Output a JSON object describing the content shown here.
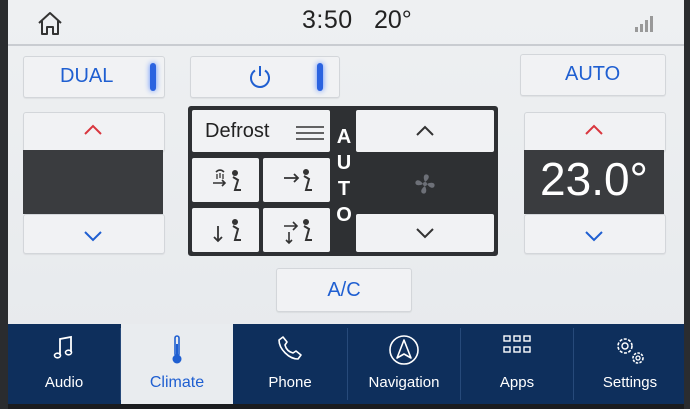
{
  "status_bar": {
    "time": "3:50",
    "outside_temp": "20°",
    "icons": [
      "home-icon",
      "signal-icon"
    ]
  },
  "climate": {
    "dual_label": "DUAL",
    "auto_label": "AUTO",
    "power_icon": "power-icon",
    "right_temp": "23.0°",
    "defrost_label": "Defrost",
    "auto_vertical": [
      "A",
      "U",
      "T",
      "O"
    ],
    "ac_label": "A/C",
    "mode_icons": [
      "windshield-face-airflow-icon",
      "face-airflow-icon",
      "feet-airflow-icon",
      "face-feet-airflow-icon"
    ],
    "fan_icon": "fan-icon"
  },
  "nav": {
    "items": [
      {
        "label": "Audio",
        "icon": "music-note-icon"
      },
      {
        "label": "Climate",
        "icon": "thermometer-icon",
        "active": true
      },
      {
        "label": "Phone",
        "icon": "phone-icon"
      },
      {
        "label": "Navigation",
        "icon": "navigation-arrow-icon"
      },
      {
        "label": "Apps",
        "icon": "apps-grid-icon"
      },
      {
        "label": "Settings",
        "icon": "settings-gears-icon"
      }
    ]
  },
  "colors": {
    "accent_blue": "#1f5fd1",
    "chevron_red": "#d9363e",
    "nav_bg": "#0e2f5c"
  }
}
